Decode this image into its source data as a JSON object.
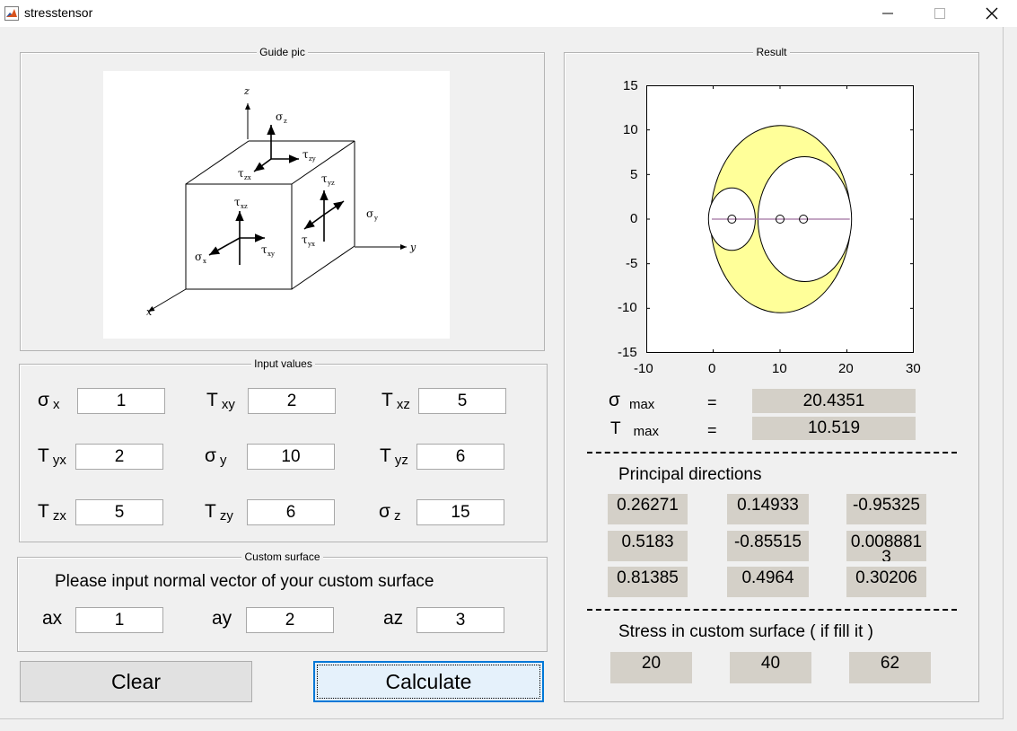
{
  "window": {
    "title": "stresstensor",
    "minimize_glyph": "—",
    "close_glyph": "✕",
    "app_icon": "matlab-logo-icon"
  },
  "guide": {
    "title": "Guide pic",
    "labels": {
      "z": "z",
      "x": "x",
      "y": "y",
      "sigma_z": "σ",
      "sigma_z_sub": "z",
      "sigma_y": "σ",
      "sigma_y_sub": "y",
      "sigma_x": "σ",
      "sigma_x_sub": "x",
      "tau_zy": "τ",
      "tau_zy_sub": "zy",
      "tau_zx": "τ",
      "tau_zx_sub": "zx",
      "tau_yz": "τ",
      "tau_yz_sub": "yz",
      "tau_xz": "τ",
      "tau_xz_sub": "xz",
      "tau_xy": "τ",
      "tau_xy_sub": "xy",
      "tau_yx": "τ",
      "tau_yx_sub": "yx"
    }
  },
  "inputs": {
    "title": "Input values",
    "fields": [
      {
        "sym": "σ",
        "sub": "x",
        "value": "1"
      },
      {
        "sym": "T",
        "sub": "xy",
        "value": "2"
      },
      {
        "sym": "T",
        "sub": "xz",
        "value": "5"
      },
      {
        "sym": "T",
        "sub": "yx",
        "value": "2"
      },
      {
        "sym": "σ",
        "sub": "y",
        "value": "10"
      },
      {
        "sym": "T",
        "sub": "yz",
        "value": "6"
      },
      {
        "sym": "T",
        "sub": "zx",
        "value": "5"
      },
      {
        "sym": "T",
        "sub": "zy",
        "value": "6"
      },
      {
        "sym": "σ",
        "sub": "z",
        "value": "15"
      }
    ]
  },
  "custom": {
    "title": "Custom surface",
    "prompt": "Please input normal vector of your custom surface",
    "fields": [
      {
        "label": "ax",
        "value": "1"
      },
      {
        "label": "ay",
        "value": "2"
      },
      {
        "label": "az",
        "value": "3"
      }
    ]
  },
  "buttons": {
    "clear": "Clear",
    "calculate": "Calculate"
  },
  "result": {
    "title": "Result",
    "sigma_max": {
      "sym": "σ",
      "sub": "max",
      "eq": "=",
      "value": "20.4351"
    },
    "tau_max": {
      "sym": "T",
      "sub": "max",
      "eq": "=",
      "value": "10.519"
    },
    "principal_title": "Principal directions",
    "principal": [
      [
        "0.26271",
        "0.14933",
        "-0.95325"
      ],
      [
        "0.5183",
        "-0.85515",
        "0.008881"
      ],
      [
        "0.81385",
        "0.4964",
        "0.30206"
      ]
    ],
    "principal_overflow_digit": "3",
    "stress_title": "Stress in custom surface ( if fill it )",
    "stress": [
      "20",
      "40",
      "62"
    ]
  },
  "chart_data": {
    "type": "mohr-circle",
    "x_ticks": [
      "-10",
      "0",
      "10",
      "20",
      "30"
    ],
    "y_ticks": [
      "15",
      "10",
      "5",
      "0",
      "-5",
      "-10",
      "-15"
    ],
    "xlim": [
      -10,
      30
    ],
    "ylim": [
      -15,
      15
    ],
    "principal_stresses": [
      -0.2,
      2.8,
      10.0,
      13.5,
      20.43
    ],
    "circles": [
      {
        "center": 10.1,
        "radius": 10.5,
        "fill": "#ffff99"
      },
      {
        "center": 2.8,
        "radius": 3.5,
        "fill": "#ffffff"
      },
      {
        "center": 13.7,
        "radius": 7.0,
        "fill": "#ffffff"
      }
    ],
    "points": [
      {
        "x": 2.8,
        "y": 0
      },
      {
        "x": 10.0,
        "y": 0
      },
      {
        "x": 13.5,
        "y": 0
      }
    ],
    "axis_line": {
      "y": 0,
      "x_from": -0.2,
      "x_to": 20.43,
      "color": "#a070a0"
    }
  }
}
